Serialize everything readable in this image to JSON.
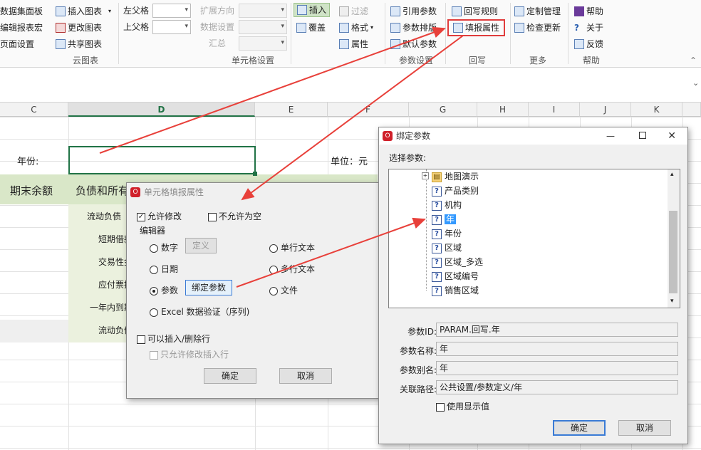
{
  "ribbon": {
    "yuntu": {
      "items": [
        "数据集面板",
        "编辑报表宏",
        "页面设置",
        "插入图表",
        "更改图表",
        "共享图表"
      ],
      "group": "云图表"
    },
    "cell": {
      "left_parent": "左父格",
      "top_parent": "上父格",
      "expand": "扩展方向",
      "dataset": "数据设置",
      "summary": "汇总",
      "group": "单元格设置"
    },
    "edit": {
      "insert": "插入",
      "overwrite": "覆盖",
      "filter": "过滤",
      "format": "格式",
      "attr": "属性"
    },
    "param": {
      "ref": "引用参数",
      "layout": "参数排版",
      "default": "默认参数",
      "group": "参数设置"
    },
    "writeback": {
      "rule": "回写规则",
      "fill": "填报属性",
      "group": "回写"
    },
    "more": {
      "custom": "定制管理",
      "check": "检查更新",
      "group": "更多"
    },
    "help": {
      "help": "帮助",
      "about": "关于",
      "feedback": "反馈",
      "group": "帮助"
    }
  },
  "columns": [
    "C",
    "D",
    "E",
    "F",
    "G",
    "H",
    "I",
    "J",
    "K"
  ],
  "sheet": {
    "year_label": "年份:",
    "unit": "单位：元",
    "hdr_end": "期末余额",
    "hdr_liab": "负债和所有",
    "rows": [
      "流动负债",
      "短期借款",
      "交易性金",
      "应付票据",
      "一年内到期",
      "流动负债"
    ]
  },
  "cell_dialog": {
    "title": "单元格填报属性",
    "allow_edit": "允许修改",
    "not_empty": "不允许为空",
    "editor": "编辑器",
    "number": "数字",
    "define": "定义",
    "single": "单行文本",
    "date": "日期",
    "multi": "多行文本",
    "param": "参数",
    "bind": "绑定参数",
    "file": "文件",
    "excel": "Excel 数据验证（序列)",
    "insert_del": "可以插入/删除行",
    "only_insert": "只允许修改插入行",
    "ok": "确定",
    "cancel": "取消"
  },
  "bind_dialog": {
    "title": "绑定参数",
    "select": "选择参数:",
    "tree": [
      "地图演示",
      "产品类别",
      "机构",
      "年",
      "年份",
      "区域",
      "区域_多选",
      "区域编号",
      "销售区域"
    ],
    "id_label": "参数ID:",
    "id": "PARAM.回写.年",
    "name_label": "参数名称:",
    "name": "年",
    "alias_label": "参数别名:",
    "alias": "年",
    "path_label": "关联路径:",
    "path": "公共设置/参数定义/年",
    "use_display": "使用显示值",
    "ok": "确定",
    "cancel": "取消"
  }
}
